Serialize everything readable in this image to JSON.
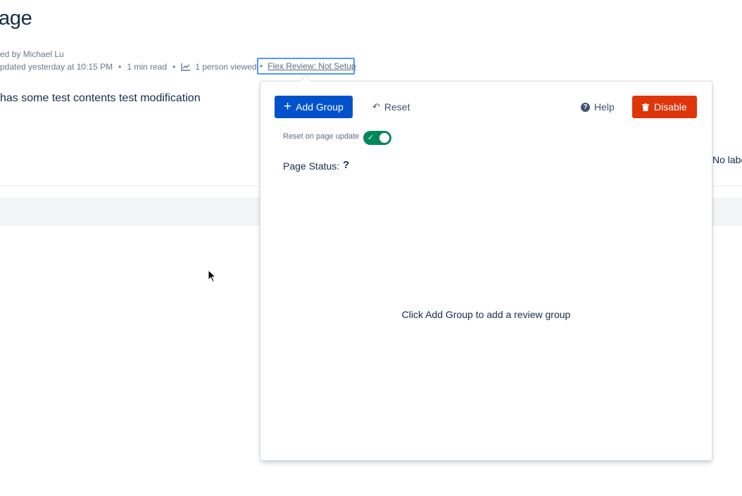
{
  "page": {
    "title": "age",
    "byline": "ed by Michael Lu",
    "meta": {
      "updated": "pdated yesterday at 10:15 PM",
      "read_time": "1 min read",
      "views": "1 person viewed"
    },
    "flex_review_link": "Flex Review: Not Setup",
    "content": "has some test contents test modification",
    "labels_text": "No labe"
  },
  "popup": {
    "add_group_label": "Add Group",
    "reset_label": "Reset",
    "help_label": "Help",
    "disable_label": "Disable",
    "toggle_label": "Reset on page update",
    "toggle_on": true,
    "page_status_label": "Page Status:",
    "page_status_value": "?",
    "empty_message": "Click Add Group to add a review group"
  },
  "colors": {
    "primary": "#0052cc",
    "danger": "#de350b",
    "toggle_on": "#00875a",
    "focus": "#4c9aff"
  }
}
